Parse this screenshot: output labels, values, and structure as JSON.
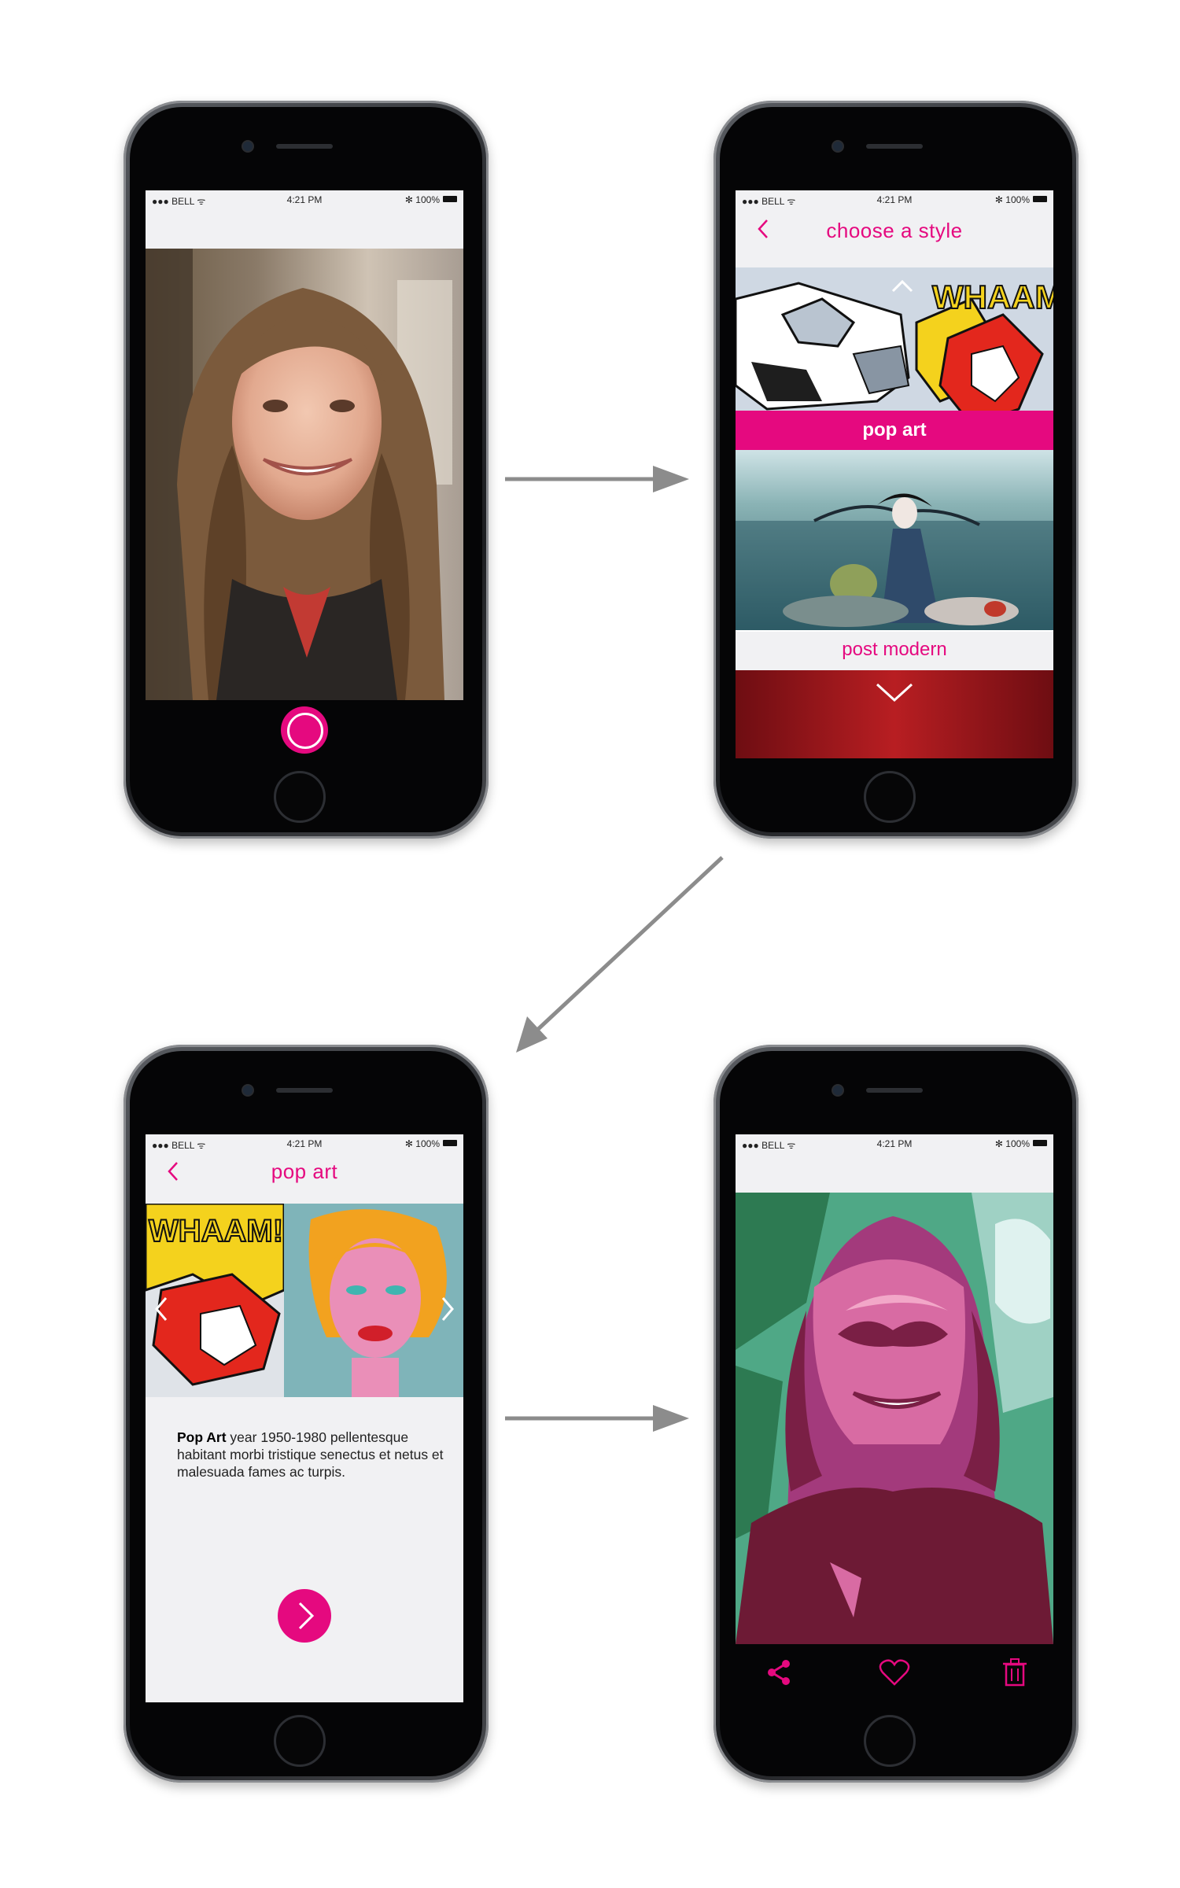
{
  "status": {
    "carrier": "●●● BELL ᯤ",
    "time": "4:21 PM",
    "battery": "✻ 100%"
  },
  "screen2": {
    "title": "choose a style",
    "styles": [
      "pop art",
      "post modern"
    ]
  },
  "screen3": {
    "title": "pop art",
    "description_bold": "Pop Art",
    "description_rest": " year 1950-1980 pellentesque habitant morbi tristique senectus et netus et malesuada fames ac turpis."
  },
  "screen4": {
    "icons": [
      "share-icon",
      "heart-icon",
      "trash-icon"
    ]
  },
  "colors": {
    "accent": "#e5097f",
    "dark": "#050506",
    "flow_arrow": "#8c8c8c"
  }
}
